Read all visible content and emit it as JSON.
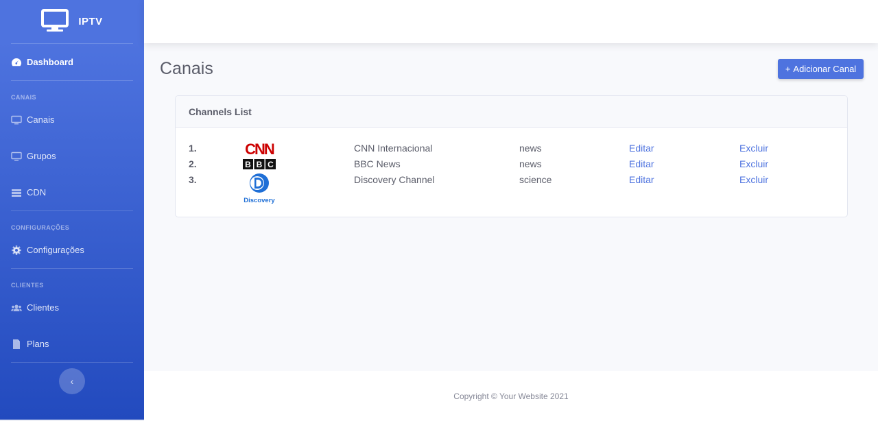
{
  "brand": {
    "name": "IPTV"
  },
  "sidebar": {
    "dashboard": "Dashboard",
    "sections": {
      "canais_heading": "CANAIS",
      "config_heading": "CONFIGURAÇÕES",
      "clientes_heading": "CLIENTES"
    },
    "items": {
      "canais": "Canais",
      "grupos": "Grupos",
      "cdn": "CDN",
      "configuracoes": "Configurações",
      "clientes": "Clientes",
      "plans": "Plans"
    },
    "toggle_icon": "‹"
  },
  "main": {
    "title": "Canais",
    "add_button": {
      "icon": "+",
      "label": "Adicionar Canal"
    },
    "card_title": "Channels List",
    "channels": [
      {
        "num": "1.",
        "logo": "cnn-logo",
        "logo_text": "CNN",
        "name": "CNN Internacional",
        "category": "news",
        "edit": "Editar",
        "delete": "Excluir"
      },
      {
        "num": "2.",
        "logo": "bbc-logo",
        "logo_text": "BBC",
        "name": "BBC News",
        "category": "news",
        "edit": "Editar",
        "delete": "Excluir"
      },
      {
        "num": "3.",
        "logo": "discovery-logo",
        "logo_text": "Discovery",
        "name": "Discovery Channel",
        "category": "science",
        "edit": "Editar",
        "delete": "Excluir"
      }
    ]
  },
  "footer": {
    "copyright": "Copyright © Your Website 2021"
  },
  "colors": {
    "primary": "#4e73df",
    "sidebar_end": "#224abe",
    "text": "#5a5c69"
  }
}
